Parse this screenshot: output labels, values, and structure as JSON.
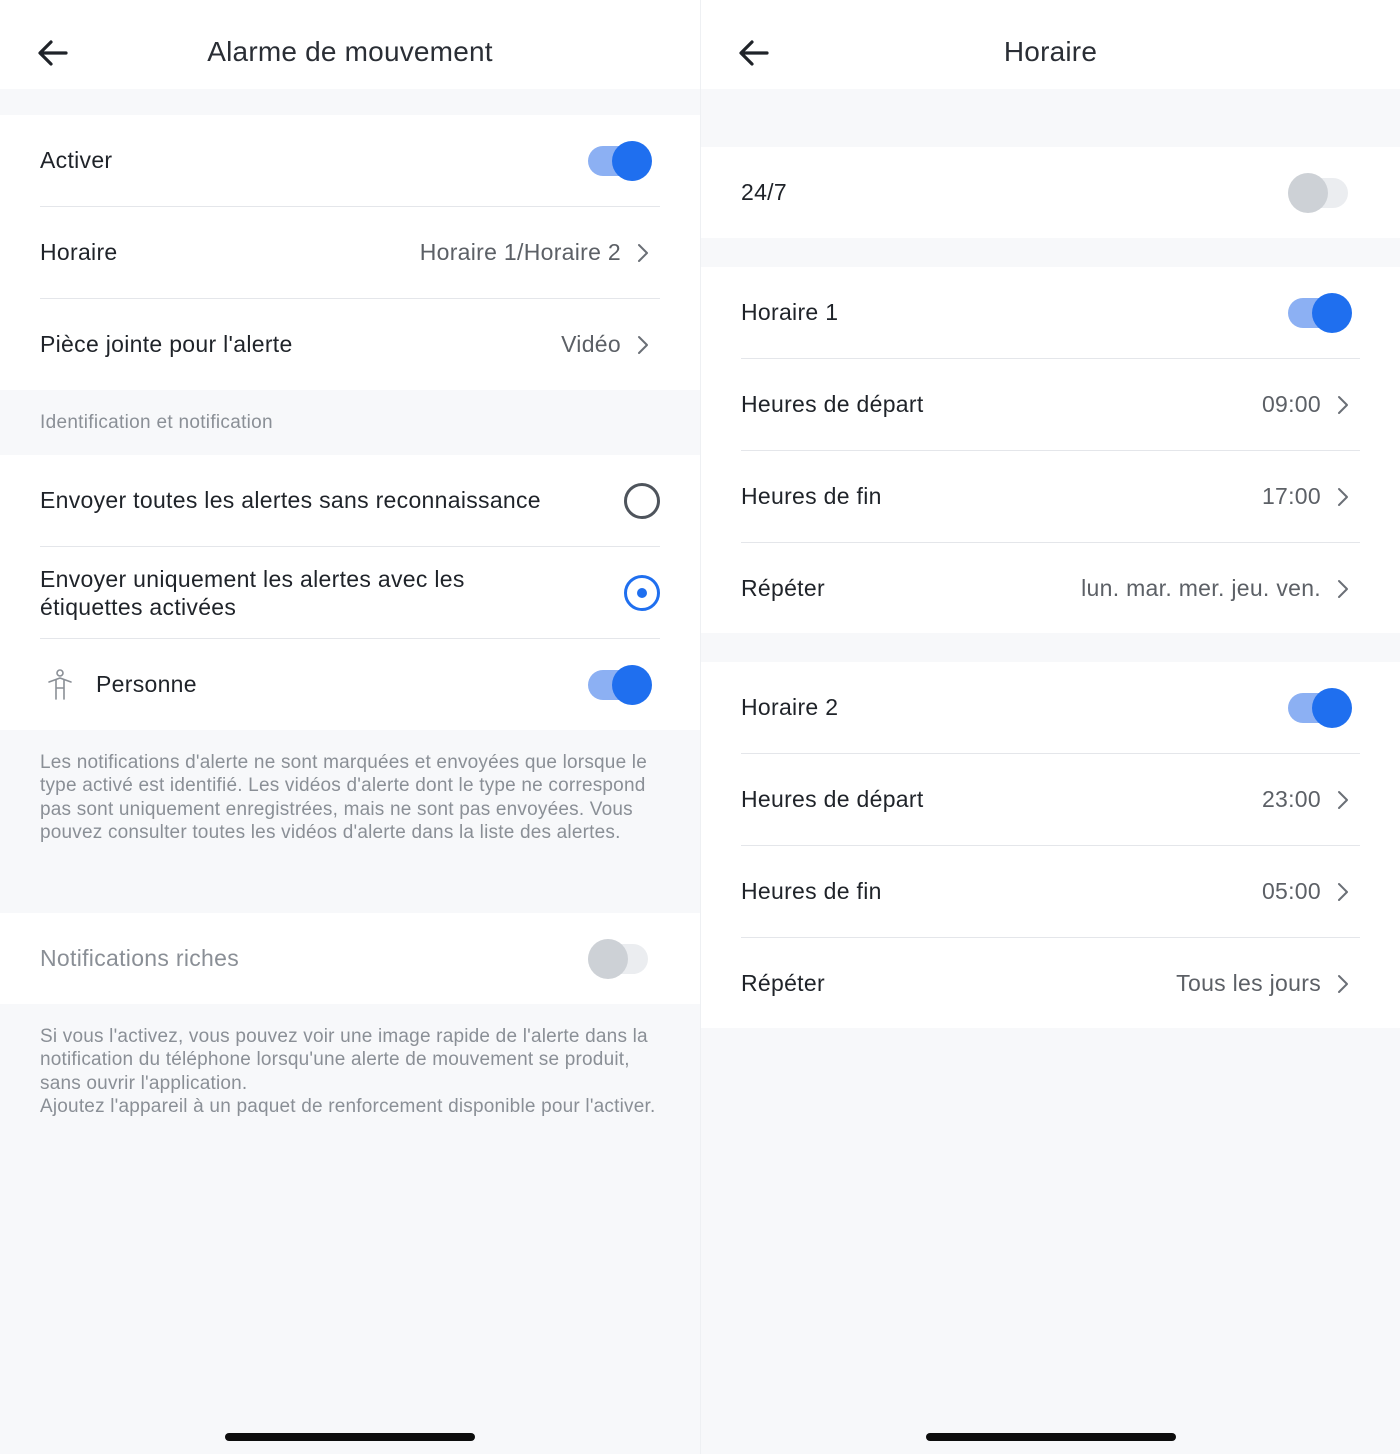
{
  "left": {
    "title": "Alarme de mouvement",
    "activate_label": "Activer",
    "activate_on": true,
    "schedule_label": "Horaire",
    "schedule_value": "Horaire 1/Horaire 2",
    "attachment_label": "Pièce jointe pour l'alerte",
    "attachment_value": "Vidéo",
    "section_identification": "Identification et notification",
    "option_all_label": "Envoyer toutes les alertes sans reconnaissance",
    "option_all_selected": false,
    "option_tagged_label_line1": "Envoyer uniquement les alertes avec les",
    "option_tagged_label_line2": "étiquettes activées",
    "option_tagged_selected": true,
    "person_label": "Personne",
    "person_on": true,
    "person_icon": "person-icon",
    "identification_note": "Les notifications d'alerte ne sont marquées et envoyées que lorsque le type activé est identifié. Les vidéos d'alerte dont le type ne correspond pas sont uniquement enregistrées, mais ne sont pas envoyées. Vous pouvez consulter toutes les vidéos d'alerte dans la liste des alertes.",
    "rich_label": "Notifications riches",
    "rich_on": false,
    "rich_note_line1": "Si vous l'activez, vous pouvez voir une image rapide de l'alerte dans la notification du téléphone lorsqu'une alerte de mouvement se produit, sans ouvrir l'application.",
    "rich_note_line2": "Ajoutez l'appareil à un paquet de renforcement disponible pour l'activer."
  },
  "right": {
    "title": "Horaire",
    "all_week_label": "24/7",
    "all_week_on": false,
    "schedule1": {
      "label": "Horaire 1",
      "on": true,
      "start_label": "Heures de départ",
      "start_value": "09:00",
      "end_label": "Heures de fin",
      "end_value": "17:00",
      "repeat_label": "Répéter",
      "repeat_value": "lun. mar. mer. jeu. ven."
    },
    "schedule2": {
      "label": "Horaire 2",
      "on": true,
      "start_label": "Heures de départ",
      "start_value": "23:00",
      "end_label": "Heures de fin",
      "end_value": "05:00",
      "repeat_label": "Répéter",
      "repeat_value": "Tous les jours"
    }
  },
  "colors": {
    "accent": "#1f6fef",
    "accent_track": "#8cb0f3",
    "text_primary": "#1f2329",
    "text_secondary": "#5c6066",
    "text_muted": "#8a8f96",
    "background": "#f7f8fa",
    "card": "#ffffff"
  }
}
